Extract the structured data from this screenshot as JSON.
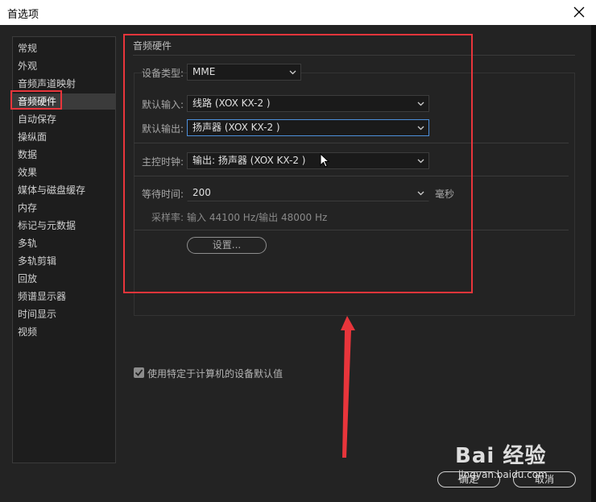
{
  "window": {
    "title": "首选项"
  },
  "sidebar": {
    "items": [
      {
        "label": "常规"
      },
      {
        "label": "外观"
      },
      {
        "label": "音频声道映射"
      },
      {
        "label": "音频硬件"
      },
      {
        "label": "自动保存"
      },
      {
        "label": "操纵面"
      },
      {
        "label": "数据"
      },
      {
        "label": "效果"
      },
      {
        "label": "媒体与磁盘缓存"
      },
      {
        "label": "内存"
      },
      {
        "label": "标记与元数据"
      },
      {
        "label": "多轨"
      },
      {
        "label": "多轨剪辑"
      },
      {
        "label": "回放"
      },
      {
        "label": "频谱显示器"
      },
      {
        "label": "时间显示"
      },
      {
        "label": "视频"
      }
    ],
    "selected_index": 3
  },
  "panel": {
    "title": "音频硬件",
    "device_type": {
      "label": "设备类型:",
      "value": "MME"
    },
    "default_input": {
      "label": "默认输入:",
      "value": "线路 (XOX KX-2 )"
    },
    "default_output": {
      "label": "默认输出:",
      "value": "扬声器 (XOX KX-2 )"
    },
    "master_clock": {
      "label": "主控时钟:",
      "value": "输出: 扬声器 (XOX KX-2 )"
    },
    "latency": {
      "label": "等待时间:",
      "value": "200",
      "unit": "毫秒"
    },
    "sample_rate": {
      "label": "采样率:",
      "value": "输入 44100 Hz/输出 48000 Hz"
    },
    "settings_button": "设置..."
  },
  "footer": {
    "checkbox_label": "使用特定于计算机的设备默认值",
    "checkbox_checked": true,
    "ok_button": "确定",
    "cancel_button": "取消"
  },
  "watermark": {
    "text": "Bai 经验",
    "url": "jingyan.baidu.com"
  },
  "colors": {
    "highlight": "#e8353b",
    "focus": "#4d8fd9",
    "background": "#232323"
  }
}
